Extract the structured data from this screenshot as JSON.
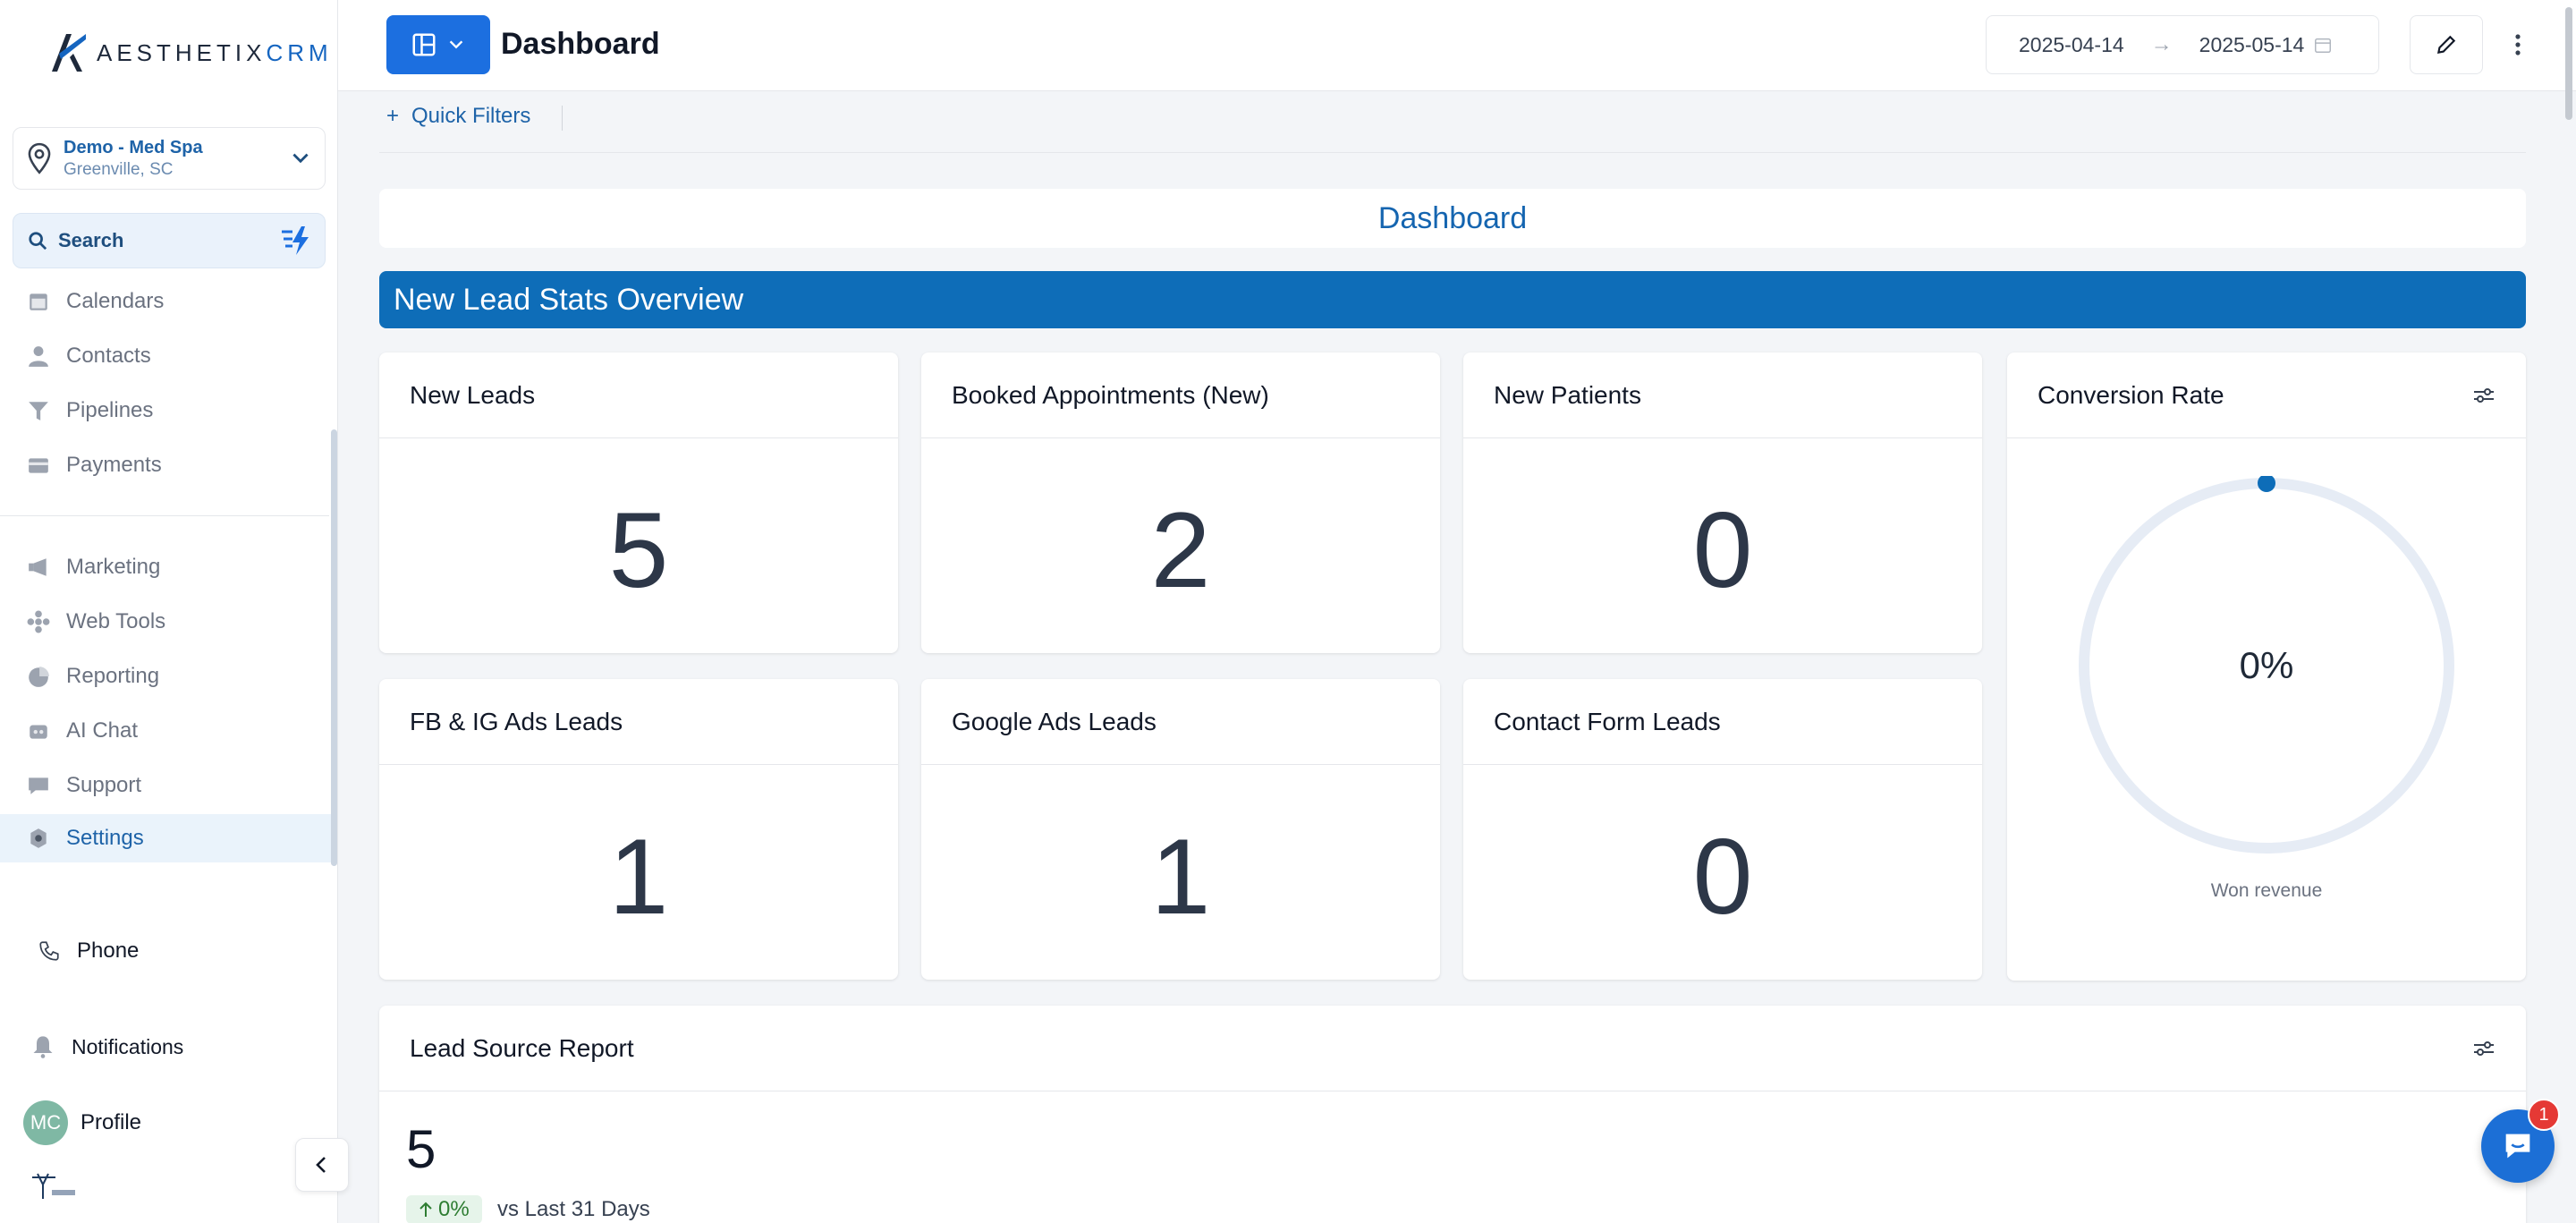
{
  "app": {
    "logo_text": "AESTHETIXCRM",
    "logo_text_a": "AESTHETIX",
    "logo_text_b": "CRM",
    "brand_color": "#1565c0"
  },
  "location": {
    "name": "Demo - Med Spa",
    "city": "Greenville, SC"
  },
  "search": {
    "label": "Search"
  },
  "sidebar": {
    "items": [
      {
        "label": "Calendars",
        "icon": "calendar-icon"
      },
      {
        "label": "Contacts",
        "icon": "person-icon"
      },
      {
        "label": "Pipelines",
        "icon": "funnel-icon"
      },
      {
        "label": "Payments",
        "icon": "card-icon"
      },
      {
        "label": "Marketing",
        "icon": "megaphone-icon"
      },
      {
        "label": "Web Tools",
        "icon": "grid-icon"
      },
      {
        "label": "Reporting",
        "icon": "pie-chart-icon"
      },
      {
        "label": "AI Chat",
        "icon": "robot-icon"
      },
      {
        "label": "Support",
        "icon": "chat-bubble-icon"
      },
      {
        "label": "Settings",
        "icon": "gear-icon",
        "active": true
      }
    ],
    "phone_label": "Phone",
    "notifications_label": "Notifications",
    "profile_label": "Profile",
    "profile_initials": "MC"
  },
  "header": {
    "title": "Dashboard",
    "date_from": "2025-04-14",
    "date_to": "2025-05-14",
    "arrow": "→"
  },
  "filters": {
    "quick_filters_label": "Quick Filters",
    "plus": "+"
  },
  "dashboard_banner": "Dashboard",
  "section_title": "New Lead Stats Overview",
  "cards": {
    "new_leads": {
      "title": "New Leads",
      "value": "5"
    },
    "booked": {
      "title": "Booked Appointments (New)",
      "value": "2"
    },
    "new_patients": {
      "title": "New Patients",
      "value": "0"
    },
    "fb_ig": {
      "title": "FB & IG Ads Leads",
      "value": "1"
    },
    "google": {
      "title": "Google Ads Leads",
      "value": "1"
    },
    "contact_form": {
      "title": "Contact Form Leads",
      "value": "0"
    },
    "conversion": {
      "title": "Conversion Rate",
      "value": "0%",
      "caption": "Won revenue",
      "fraction": 0
    }
  },
  "lead_source": {
    "title": "Lead Source Report",
    "value": "5",
    "change": "0%",
    "comparison": "vs Last 31 Days"
  },
  "chat": {
    "badge": "1"
  }
}
